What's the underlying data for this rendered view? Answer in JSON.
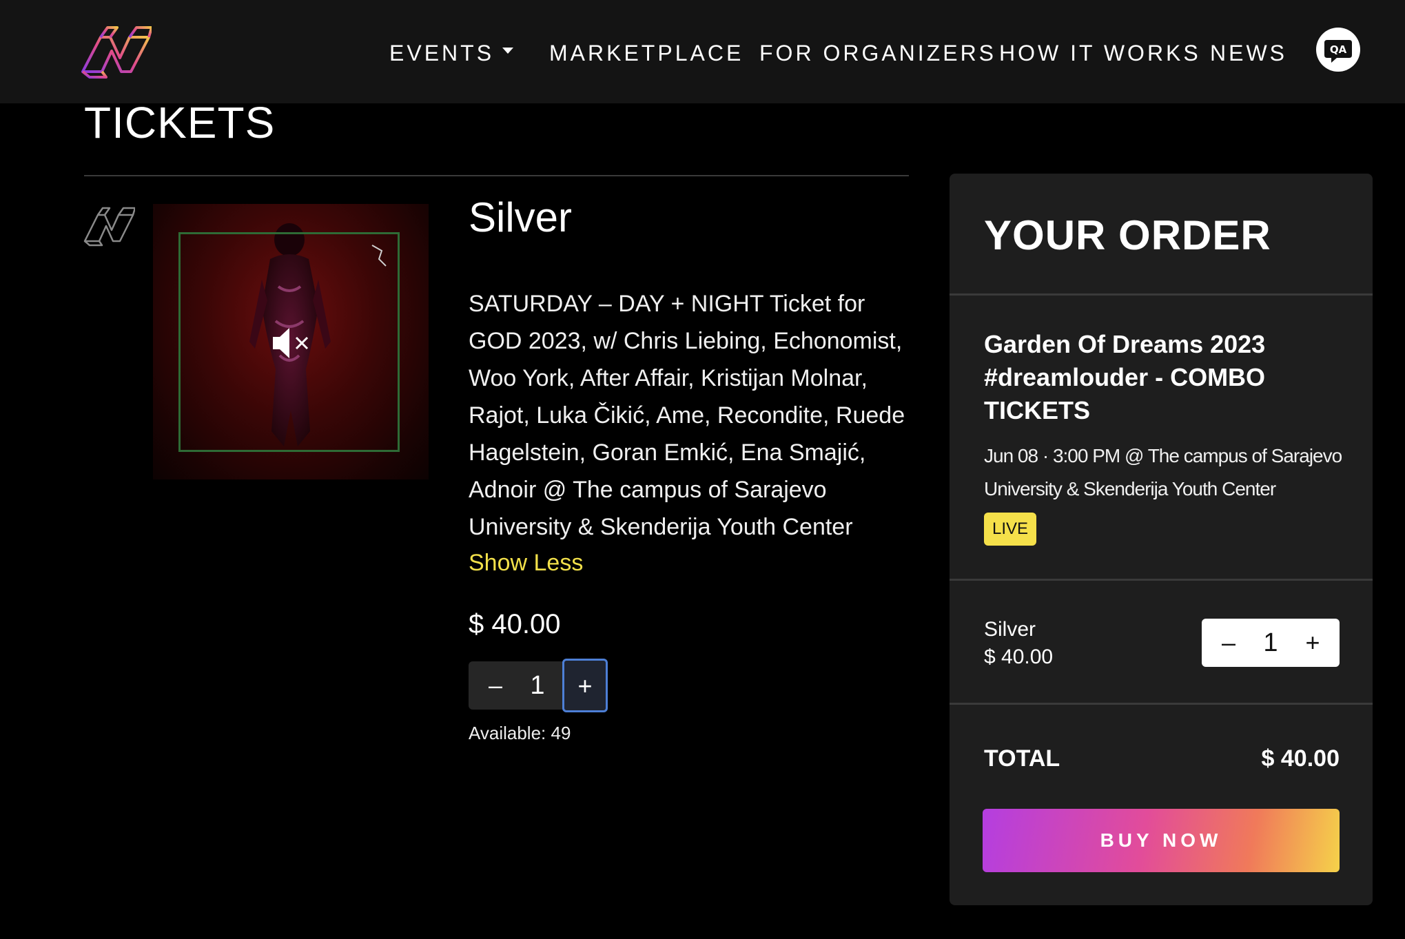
{
  "nav": {
    "items": [
      {
        "label": "EVENTS"
      },
      {
        "label": "MARKETPLACE"
      },
      {
        "label": "FOR ORGANIZERS"
      },
      {
        "label": "HOW IT WORKS"
      },
      {
        "label": "NEWS"
      }
    ],
    "qa_label": "QA"
  },
  "page": {
    "title": "TICKETS"
  },
  "ticket": {
    "name": "Silver",
    "description": "SATURDAY – DAY + NIGHT Ticket for GOD 2023, w/ Chris Liebing, Echonomist, Woo York, After Affair, Kristijan Molnar, Rajot, Luka Čikić, Ame, Recondite, Ruede Hagelstein, Goran Emkić, Ena Smajić, Adnoir @ The campus of Sarajevo University & Skenderija Youth Center",
    "show_less": "Show Less",
    "price": "$ 40.00",
    "quantity": {
      "minus": "–",
      "value": "1",
      "plus": "+"
    },
    "available": "Available: 49"
  },
  "order": {
    "title": "YOUR ORDER",
    "event_title": "Garden Of Dreams 2023 #dreamlouder - COMBO TICKETS",
    "event_meta": "Jun 08 · 3:00 PM @ The campus of Sarajevo University & Skenderija Youth Center",
    "status_badge": "LIVE",
    "line_item": {
      "name": "Silver",
      "price": "$ 40.00",
      "quantity": {
        "minus": "–",
        "value": "1",
        "plus": "+"
      }
    },
    "total_label": "TOTAL",
    "total_value": "$ 40.00",
    "buy_label": "BUY NOW"
  },
  "colors": {
    "accent_yellow": "#f2e04a",
    "focus_blue": "#4d7fd6",
    "panel_bg": "#1e1e1e",
    "gradient": [
      "#b43ee0",
      "#e24c9a",
      "#f07a5a",
      "#f5d24a"
    ]
  },
  "icons": {
    "logo": "brand-logo-icon",
    "small_logo": "brand-logo-outline-icon",
    "mute": "speaker-muted-icon",
    "chevron": "caret-down-icon",
    "qa": "qa-chat-icon"
  }
}
